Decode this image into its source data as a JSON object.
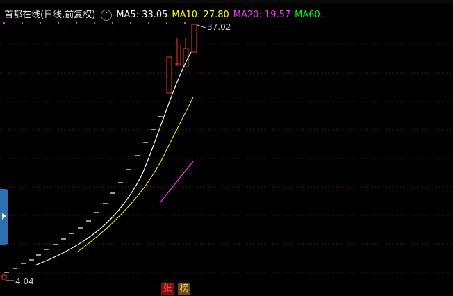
{
  "header": {
    "stock_title": "首都在线(日线,前复权)",
    "ma5": "MA5: 33.05",
    "ma10": "MA10: 27.80",
    "ma20": "MA20: 19.57",
    "ma60": "MA60: -"
  },
  "labels": {
    "max_price": "37.02",
    "min_price": "4.04"
  },
  "badges": {
    "zhang": "张",
    "bang": "榜"
  },
  "colors": {
    "ma5": "#ffffff",
    "ma10": "#ffff00",
    "ma20": "#ff33ff",
    "ma60": "#00ff00",
    "up": "#ff3333"
  },
  "chart_data": {
    "type": "line",
    "title": "首都在线(日线,前复权)",
    "y_annotations": {
      "high": 37.02,
      "low": 4.04
    },
    "series": [
      {
        "name": "MA5",
        "last": 33.05
      },
      {
        "name": "MA10",
        "last": 27.8
      },
      {
        "name": "MA20",
        "last": 19.57
      },
      {
        "name": "MA60",
        "last": null
      }
    ]
  }
}
